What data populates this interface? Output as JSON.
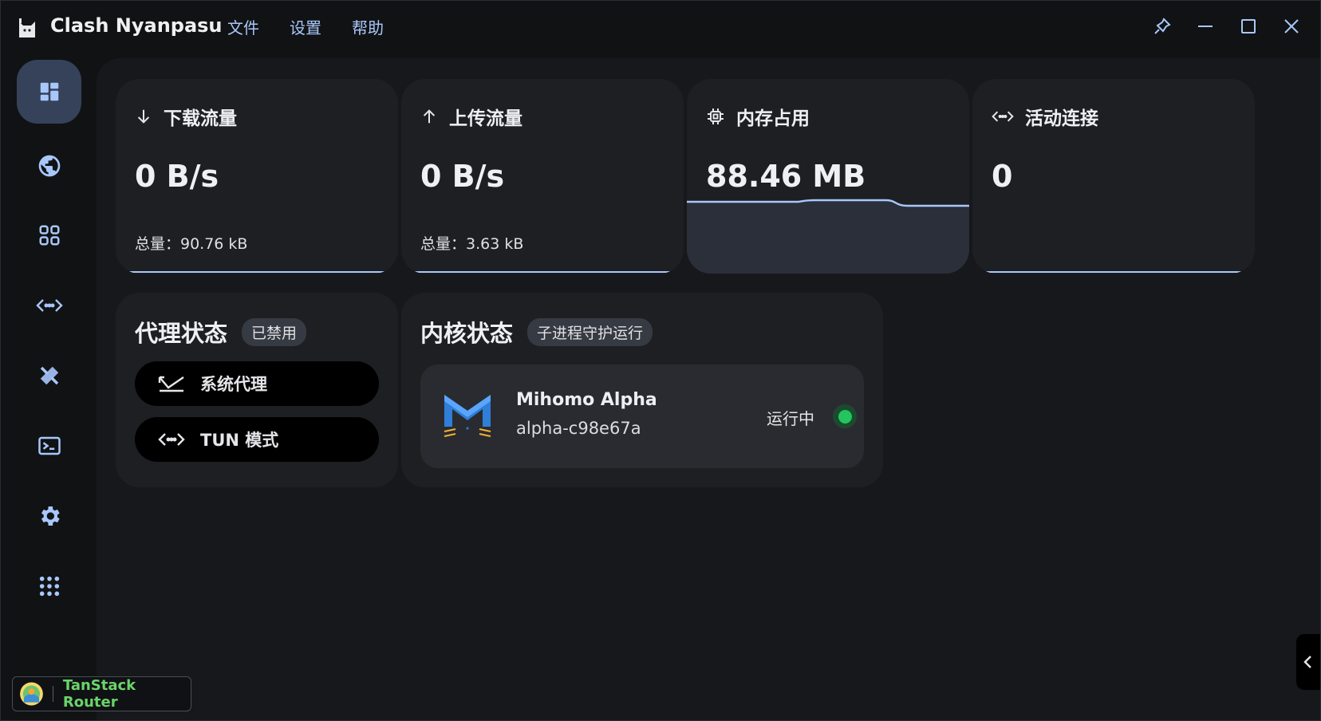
{
  "app": {
    "title": "Clash Nyanpasu"
  },
  "menu": {
    "items": [
      "文件",
      "设置",
      "帮助"
    ]
  },
  "window_controls": [
    "pin-icon",
    "minimize-icon",
    "maximize-icon",
    "close-icon"
  ],
  "sidebar": {
    "items": [
      {
        "icon": "dashboard-icon",
        "active": true
      },
      {
        "icon": "globe-icon"
      },
      {
        "icon": "grid-icon"
      },
      {
        "icon": "connections-icon"
      },
      {
        "icon": "rules-icon"
      },
      {
        "icon": "terminal-icon"
      },
      {
        "icon": "settings-icon"
      },
      {
        "icon": "apps-icon"
      }
    ]
  },
  "stats": {
    "download": {
      "title": "下载流量",
      "value": "0 B/s",
      "total": "总量：90.76 kB"
    },
    "upload": {
      "title": "上传流量",
      "value": "0 B/s",
      "total": "总量：3.63 kB"
    },
    "memory": {
      "title": "内存占用",
      "value": "88.46 MB"
    },
    "connections": {
      "title": "活动连接",
      "value": "0"
    }
  },
  "proxy_status": {
    "title": "代理状态",
    "badge": "已禁用",
    "system_proxy": "系统代理",
    "tun_mode": "TUN 模式"
  },
  "core_status": {
    "title": "内核状态",
    "badge": "子进程守护运行",
    "name": "Mihomo Alpha",
    "version": "alpha-c98e67a",
    "state": "运行中"
  },
  "devtools": {
    "label": "TanStack Router"
  },
  "colors": {
    "accent": "#a8c7fa",
    "running": "#22c55e",
    "active_nav": "#36425a"
  }
}
